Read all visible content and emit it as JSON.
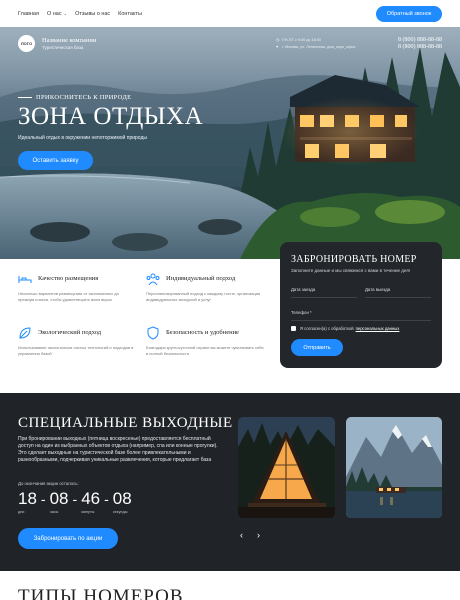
{
  "nav": {
    "items": [
      "Главная",
      "О нас",
      "Отзывы о нас",
      "Контакты"
    ],
    "cta": "Обратный звонок"
  },
  "header": {
    "logo": "ЛОГО",
    "company_name": "Название компании",
    "company_sub": "Туристическая база",
    "hours": "ПН-ПТ с 9:00 до 18:00",
    "address": "г. Москва, ул. Ленинская, дом_корп_офис",
    "phone1": "8 (800) 888-88-88",
    "phone2": "8 (800) 888-88-88"
  },
  "hero": {
    "kicker": "ПРИКОСНИТЕСЬ К ПРИРОДЕ",
    "title": "ЗОНА ОТДЫХА",
    "subtitle": "Идеальный отдых в окружении непоторжимой природы",
    "button": "Оставить заявку"
  },
  "features": [
    {
      "title": "Качество размещения",
      "text": "Несколько вариантов размещения от экономичных до премиум класса, чтобы удовлетворить всем вкусы",
      "icon": "bed-icon"
    },
    {
      "title": "Индивидуальный подход",
      "text": "Персонализированный подход к каждому гостю, организация индивидуальных экскурсий и услуг",
      "icon": "people-icon"
    },
    {
      "title": "Экологический подход",
      "text": "Использование экологически чистых технологий и подходов в управлении базой",
      "icon": "leaf-icon"
    },
    {
      "title": "Безопасность и удобнение",
      "text": "Благодаря круглосуточной охране вы можете чувствовать себя в полной безопасности",
      "icon": "shield-icon"
    }
  ],
  "booking": {
    "title": "ЗАБРОНИРОВАТЬ НОМЕР",
    "subtitle": "Заполните данные и мы свяжемся с вами в течение дня!",
    "arrival_placeholder": "Дата заезда",
    "departure_placeholder": "Дата выезда",
    "phone_placeholder": "Телефон *",
    "agree_text": "Я согласен(а) с обработкой",
    "agree_link": "персональных данных",
    "submit": "Отправить"
  },
  "specials": {
    "title": "СПЕЦИАЛЬНЫЕ ВЫХОДНЫЕ",
    "description": "При бронировании выходных (пятница воскресенье) предоставляется бесплатный доступ на один из выбранных объектов отдыха (например, спа или конные прогулки). Это сделает выходные на туристической базе более привлекательными и разнообразными, подчеркивая уникальные развлечения, которые предлагает база",
    "until": "До окончания акции осталось:",
    "countdown": [
      {
        "value": "18",
        "label": "дни"
      },
      {
        "value": "08",
        "label": "часы"
      },
      {
        "value": "46",
        "label": "минуты"
      },
      {
        "value": "08",
        "label": "секунды"
      }
    ],
    "button": "Забронировать по акции",
    "prev": "‹",
    "next": "›"
  },
  "rooms": {
    "title": "ТИПЫ НОМЕРОВ"
  },
  "colors": {
    "accent": "#1f8bff",
    "dark": "#202428",
    "card": "#23272b"
  }
}
